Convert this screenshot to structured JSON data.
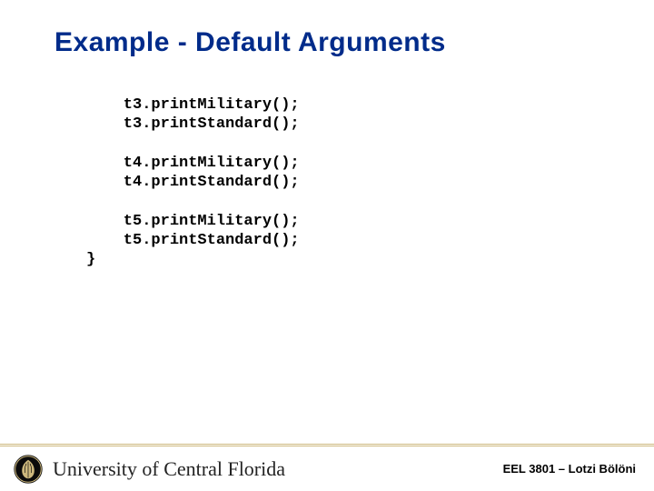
{
  "title": "Example - Default Arguments",
  "code": {
    "block1": {
      "l1": "    t3.printMilitary();",
      "l2": "    t3.printStandard();"
    },
    "block2": {
      "l1": "    t4.printMilitary();",
      "l2": "    t4.printStandard();"
    },
    "block3": {
      "l1": "    t5.printMilitary();",
      "l2": "    t5.printStandard();"
    },
    "close": "}"
  },
  "footer": {
    "university": "University of Central Florida",
    "course": "EEL 3801 – Lotzi Bölöni"
  }
}
